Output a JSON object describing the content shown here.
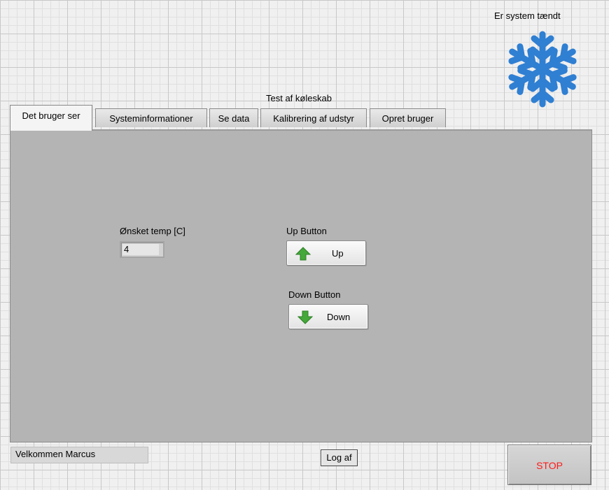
{
  "indicator": {
    "label": "Er system tændt",
    "icon": "snowflake-icon",
    "color": "#2f7fd3"
  },
  "tabs": {
    "title": "Test af køleskab",
    "items": [
      {
        "label": "Det bruger ser",
        "active": true
      },
      {
        "label": "Systeminformationer"
      },
      {
        "label": "Se data"
      },
      {
        "label": "Kalibrering af udstyr"
      },
      {
        "label": "Opret bruger"
      }
    ]
  },
  "controls": {
    "temp_label": "Ønsket temp [C]",
    "temp_value": "4",
    "up_label": "Up Button",
    "up_text": "Up",
    "down_label": "Down Button",
    "down_text": "Down",
    "arrow_color": "#45a83a"
  },
  "footer": {
    "welcome": "Velkommen Marcus",
    "logout": "Log af",
    "stop": "STOP",
    "stop_color": "#ff1a1a"
  }
}
